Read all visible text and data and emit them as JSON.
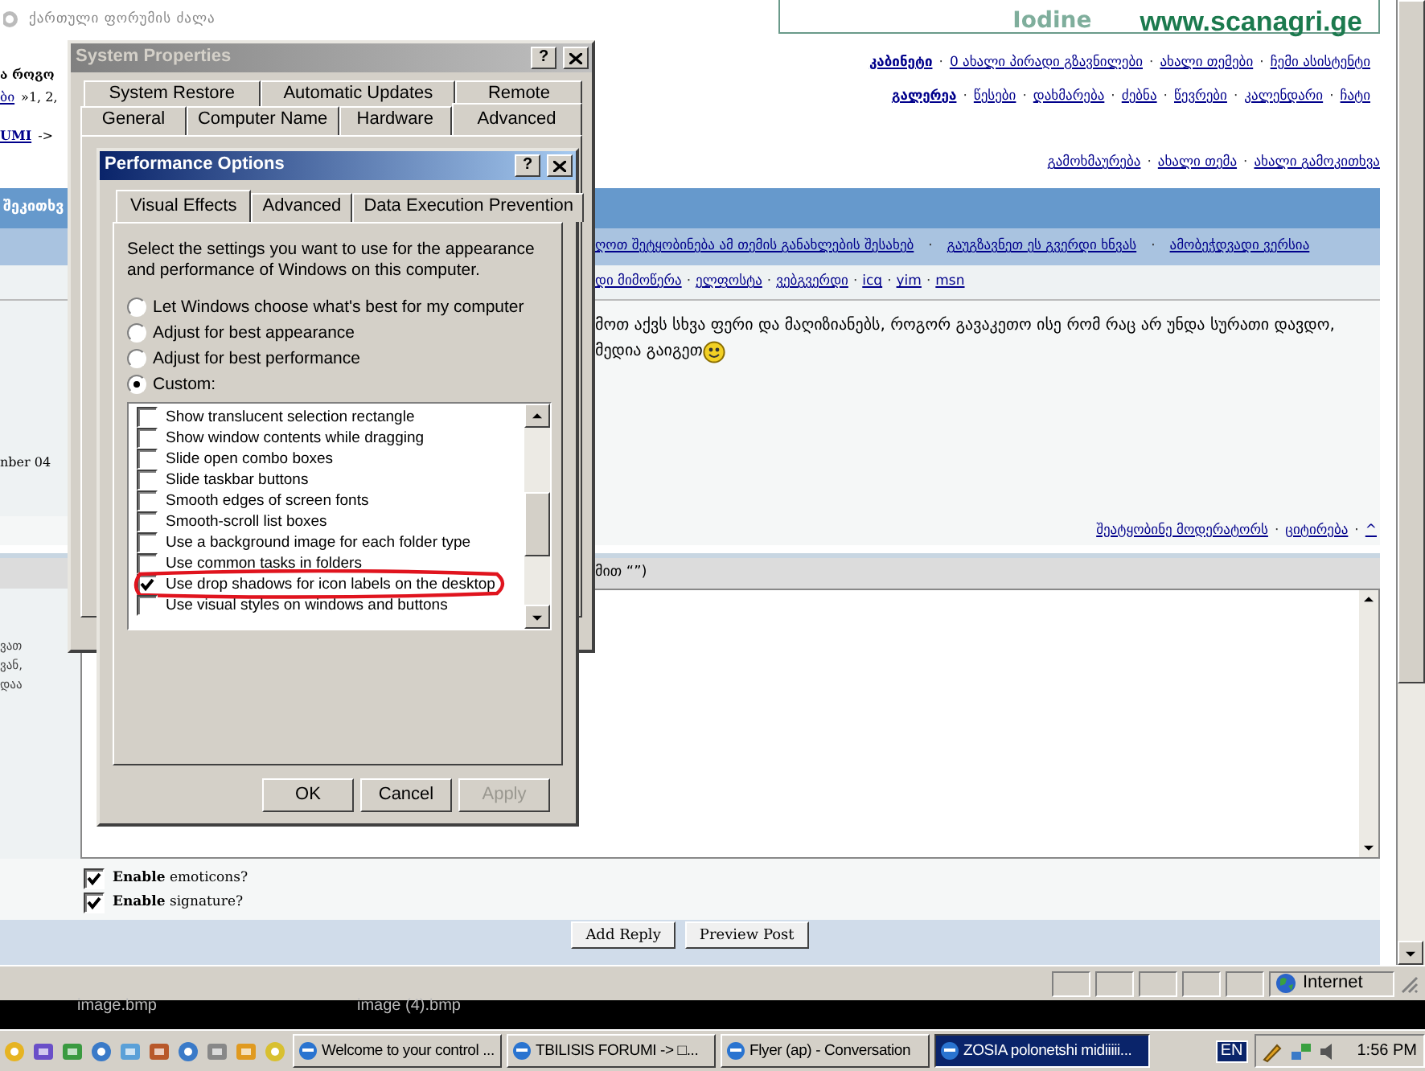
{
  "browser_page": {
    "logo_text": "ქართული ფორუმის ძალა",
    "banner": {
      "faint_text": "Iodine",
      "url": "www.scanagri.ge"
    },
    "left_lines": [
      [
        {
          "text": "ა როგო",
          "kind": "bold"
        }
      ],
      [
        {
          "text": "ბი",
          "kind": "link"
        },
        {
          "text": "»1, 2,",
          "kind": "plain"
        }
      ],
      [
        {
          "text": "UMI",
          "kind": "boldlink"
        },
        {
          "text": "->",
          "kind": "plain"
        }
      ]
    ],
    "nav_rows": [
      {
        "separator": "·",
        "links": [
          {
            "text": "კაბინეტი",
            "bold": true
          },
          {
            "text": "0 ახალი პირადი გზავნილები",
            "bold": false
          },
          {
            "text": "ახალი თემები",
            "bold": false
          },
          {
            "text": "ჩემი ასისტენტი",
            "bold": false
          }
        ]
      },
      {
        "separator": "·",
        "links": [
          {
            "text": "გალერეა",
            "bold": true
          },
          {
            "text": "წესები",
            "bold": false
          },
          {
            "text": "დახმარება",
            "bold": false
          },
          {
            "text": "ძებნა",
            "bold": false
          },
          {
            "text": "წევრები",
            "bold": false
          },
          {
            "text": "კალენდარი",
            "bold": false
          },
          {
            "text": "ჩატი",
            "bold": false
          }
        ]
      },
      {
        "separator": "·",
        "links": [
          {
            "text": "გამოხმაურება",
            "bold": false
          },
          {
            "text": "ახალი თემა",
            "bold": false
          },
          {
            "text": "ახალი გამოკითხვა",
            "bold": false
          }
        ]
      }
    ],
    "section_title": "შეკითხვ",
    "topic_links": {
      "separator": "·",
      "links": [
        "ღოთ შეტყობინება ამ თემის განახლების შესახებ",
        "გაუგზავნეთ ეს გვერდი ხნვას",
        "ამობეჭდვადი ვერსია"
      ]
    },
    "contact_links": {
      "separator": "·",
      "links": [
        "დი მიმოწერა",
        "ელფოსტა",
        "ვებგვერდი",
        "icq",
        "yim",
        "msn"
      ]
    },
    "post_date": "nber 04",
    "post_lines": [
      "მოთ აქვს სხვა ფერი და მაღიზიანებს, როგორ გავაკეთო ისე რომ რაც არ უნდა სურათი დავდო,",
      "მედია გაიგეთ"
    ],
    "post_links": {
      "separator": "·",
      "links": [
        "შეატყობინე მოდერატორს",
        "ციტირება",
        "^"
      ]
    },
    "reply_header": "მით “”)",
    "side_fragments": [
      "ვათ",
      "ვან,",
      "დაა"
    ],
    "options": [
      {
        "text": "**Enable** emoticons?",
        "checked": true
      },
      {
        "text": "**Enable** signature?",
        "checked": true
      }
    ],
    "buttons": [
      "Add Reply",
      "Preview Post"
    ],
    "status": "Internet"
  },
  "desktop_labels": [
    "image.bmp",
    "image (4).bmp"
  ],
  "system_properties": {
    "title": "System Properties",
    "help": "?",
    "tab_rows": [
      [
        {
          "label": "System Restore",
          "selected": false
        },
        {
          "label": "Automatic Updates",
          "selected": false
        },
        {
          "label": "Remote",
          "selected": false
        }
      ],
      [
        {
          "label": "General",
          "selected": false
        },
        {
          "label": "Computer Name",
          "selected": false
        },
        {
          "label": "Hardware",
          "selected": false
        },
        {
          "label": "Advanced",
          "selected": true
        }
      ]
    ]
  },
  "performance_options": {
    "title": "Performance Options",
    "help": "?",
    "tabs": [
      {
        "label": "Visual Effects",
        "selected": true
      },
      {
        "label": "Advanced",
        "selected": false
      },
      {
        "label": "Data Execution Prevention",
        "selected": false
      }
    ],
    "intro": "Select the settings you want to use for the appearance and performance of Windows on this computer.",
    "modes": [
      {
        "label": "Let Windows choose what's best for my computer",
        "selected": false
      },
      {
        "label": "Adjust for best appearance",
        "selected": false
      },
      {
        "label": "Adjust for best performance",
        "selected": false
      },
      {
        "label": "Custom:",
        "selected": true
      }
    ],
    "effects": [
      {
        "label": "Show translucent selection rectangle",
        "checked": false,
        "circled": false
      },
      {
        "label": "Show window contents while dragging",
        "checked": false,
        "circled": false
      },
      {
        "label": "Slide open combo boxes",
        "checked": false,
        "circled": false
      },
      {
        "label": "Slide taskbar buttons",
        "checked": false,
        "circled": false
      },
      {
        "label": "Smooth edges of screen fonts",
        "checked": false,
        "circled": false
      },
      {
        "label": "Smooth-scroll list boxes",
        "checked": false,
        "circled": false
      },
      {
        "label": "Use a background image for each folder type",
        "checked": false,
        "circled": false
      },
      {
        "label": "Use common tasks in folders",
        "checked": false,
        "circled": false
      },
      {
        "label": "Use drop shadows for icon labels on the desktop",
        "checked": true,
        "circled": true
      },
      {
        "label": "Use visual styles on windows and buttons",
        "checked": false,
        "circled": false
      }
    ],
    "buttons": [
      {
        "label": "OK",
        "disabled": false
      },
      {
        "label": "Cancel",
        "disabled": false
      },
      {
        "label": "Apply",
        "disabled": true
      }
    ]
  },
  "taskbar": {
    "tasks": [
      {
        "label": "Welcome to your control ...",
        "selected": false
      },
      {
        "label": "TBILISIS FORUMI -> □...",
        "selected": false
      },
      {
        "label": "Flyer (ap) - Conversation",
        "selected": false
      },
      {
        "label": "ZOSIA polonetshi midiiiii...",
        "selected": true
      }
    ],
    "language": "EN",
    "clock": "1:56 PM"
  }
}
